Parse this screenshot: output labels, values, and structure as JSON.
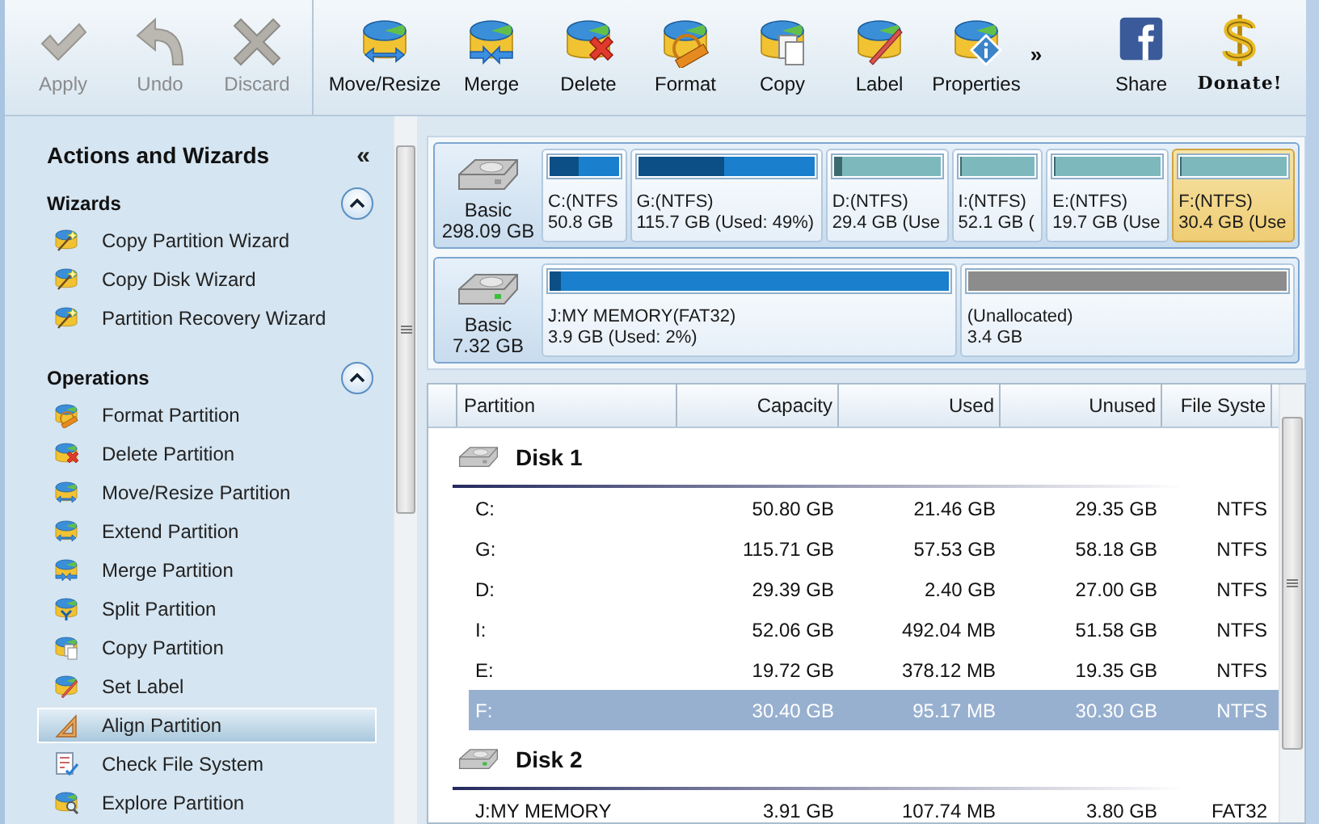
{
  "toolbar": {
    "groups": [
      {
        "items": [
          {
            "label": "Apply",
            "disabled": true
          },
          {
            "label": "Undo",
            "disabled": true
          },
          {
            "label": "Discard",
            "disabled": true
          }
        ]
      },
      {
        "items": [
          {
            "label": "Move/Resize",
            "disabled": false
          },
          {
            "label": "Merge",
            "disabled": false
          },
          {
            "label": "Delete",
            "disabled": false
          },
          {
            "label": "Format",
            "disabled": false
          },
          {
            "label": "Copy",
            "disabled": false
          },
          {
            "label": "Label",
            "disabled": false
          },
          {
            "label": "Properties",
            "disabled": false
          }
        ]
      }
    ],
    "more": "»",
    "extras": [
      {
        "label": "Share"
      },
      {
        "label": "Donate!"
      }
    ]
  },
  "sidebar": {
    "title": "Actions and Wizards",
    "collapse": "«",
    "sections": [
      {
        "title": "Wizards",
        "expanded": true,
        "items": [
          {
            "label": "Copy Partition Wizard",
            "selected": false
          },
          {
            "label": "Copy Disk Wizard",
            "selected": false
          },
          {
            "label": "Partition Recovery Wizard",
            "selected": false
          }
        ]
      },
      {
        "title": "Operations",
        "expanded": true,
        "items": [
          {
            "label": "Format Partition",
            "selected": false
          },
          {
            "label": "Delete Partition",
            "selected": false
          },
          {
            "label": "Move/Resize Partition",
            "selected": false
          },
          {
            "label": "Extend Partition",
            "selected": false
          },
          {
            "label": "Merge Partition",
            "selected": false
          },
          {
            "label": "Split Partition",
            "selected": false
          },
          {
            "label": "Copy Partition",
            "selected": false
          },
          {
            "label": "Set Label",
            "selected": false
          },
          {
            "label": "Align Partition",
            "selected": true
          },
          {
            "label": "Check File System",
            "selected": false
          },
          {
            "label": "Explore Partition",
            "selected": false
          }
        ]
      }
    ]
  },
  "disk_map": [
    {
      "type": "Basic",
      "size": "298.09 GB",
      "partitions": [
        {
          "name": "C:(NTFS",
          "info": "50.8 GB",
          "kind": "primary",
          "level": 0.42,
          "selected": false
        },
        {
          "name": "G:(NTFS)",
          "info": "115.7 GB (Used: 49%)",
          "kind": "primary",
          "level": 0.49,
          "selected": false
        },
        {
          "name": "D:(NTFS)",
          "info": "29.4 GB (Use",
          "kind": "logical",
          "level": 0.08,
          "selected": false
        },
        {
          "name": "I:(NTFS)",
          "info": "52.1 GB (",
          "kind": "logical",
          "level": 0.01,
          "selected": false
        },
        {
          "name": "E:(NTFS)",
          "info": "19.7 GB (Use",
          "kind": "logical",
          "level": 0.02,
          "selected": false
        },
        {
          "name": "F:(NTFS)",
          "info": "30.4 GB (Use",
          "kind": "logical",
          "level": 0.01,
          "selected": true
        }
      ]
    },
    {
      "type": "Basic",
      "size": "7.32 GB",
      "partitions": [
        {
          "name": "J:MY MEMORY(FAT32)",
          "info": "3.9 GB (Used: 2%)",
          "kind": "primary",
          "level": 0.03,
          "selected": false
        },
        {
          "name": "(Unallocated)",
          "info": "3.4 GB",
          "kind": "unallocated",
          "selected": false
        }
      ]
    }
  ],
  "table": {
    "columns": [
      "Partition",
      "Capacity",
      "Used",
      "Unused",
      "File Syste"
    ],
    "groups": [
      {
        "title": "Disk 1",
        "rows": [
          {
            "cells": [
              "C:",
              "50.80 GB",
              "21.46 GB",
              "29.35 GB",
              "NTFS"
            ],
            "selected": false
          },
          {
            "cells": [
              "G:",
              "115.71 GB",
              "57.53 GB",
              "58.18 GB",
              "NTFS"
            ],
            "selected": false
          },
          {
            "cells": [
              "D:",
              "29.39 GB",
              "2.40 GB",
              "27.00 GB",
              "NTFS"
            ],
            "selected": false
          },
          {
            "cells": [
              "I:",
              "52.06 GB",
              "492.04 MB",
              "51.58 GB",
              "NTFS"
            ],
            "selected": false
          },
          {
            "cells": [
              "E:",
              "19.72 GB",
              "378.12 MB",
              "19.35 GB",
              "NTFS"
            ],
            "selected": false
          },
          {
            "cells": [
              "F:",
              "30.40 GB",
              "95.17 MB",
              "30.30 GB",
              "NTFS"
            ],
            "selected": true
          }
        ]
      },
      {
        "title": "Disk 2",
        "rows": [
          {
            "cells": [
              "J:MY MEMORY",
              "3.91 GB",
              "107.74 MB",
              "3.80 GB",
              "FAT32"
            ],
            "selected": false
          }
        ]
      }
    ]
  }
}
